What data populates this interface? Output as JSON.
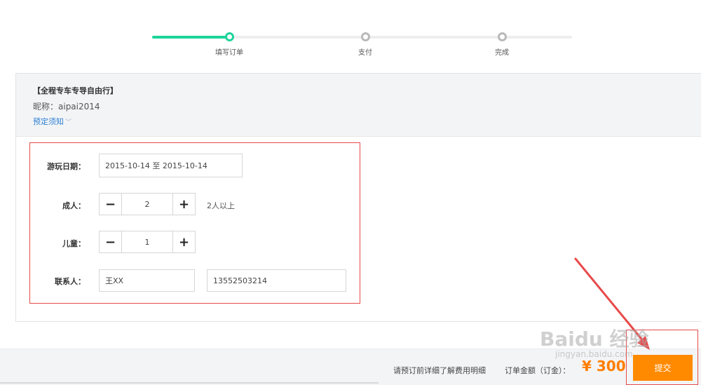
{
  "steps": [
    {
      "label": "填写订单",
      "state": "active"
    },
    {
      "label": "支付",
      "state": "pending"
    },
    {
      "label": "完成",
      "state": "pending"
    }
  ],
  "product": {
    "title": "【全程专车专导自由行】",
    "nickname": "昵称：aipai2014",
    "notice_link": "预定须知",
    "notice_chevron": "chevron-down-icon"
  },
  "form": {
    "date_label": "游玩日期：",
    "date_value": "2015-10-14 至 2015-10-14",
    "adult_label": "成人：",
    "adult_count": "2",
    "adult_hint": "2人以上",
    "child_label": "儿童：",
    "child_count": "1",
    "minus": "−",
    "plus": "+",
    "contact_label": "联系人：",
    "contact_name": "王XX",
    "contact_phone": "13552503214"
  },
  "footer": {
    "note": "请预订前详细了解费用明细",
    "amount_label": "订单金额（订金）：",
    "amount": "¥ 300",
    "submit_label": "提交"
  },
  "watermark": {
    "brand": "Baidu 经验",
    "sub": "jingyan.baidu.com"
  },
  "colors": {
    "progress": "#1ed49b",
    "accent": "#ff8a00",
    "link": "#2b7fd3",
    "highlight": "#e84a4a"
  }
}
